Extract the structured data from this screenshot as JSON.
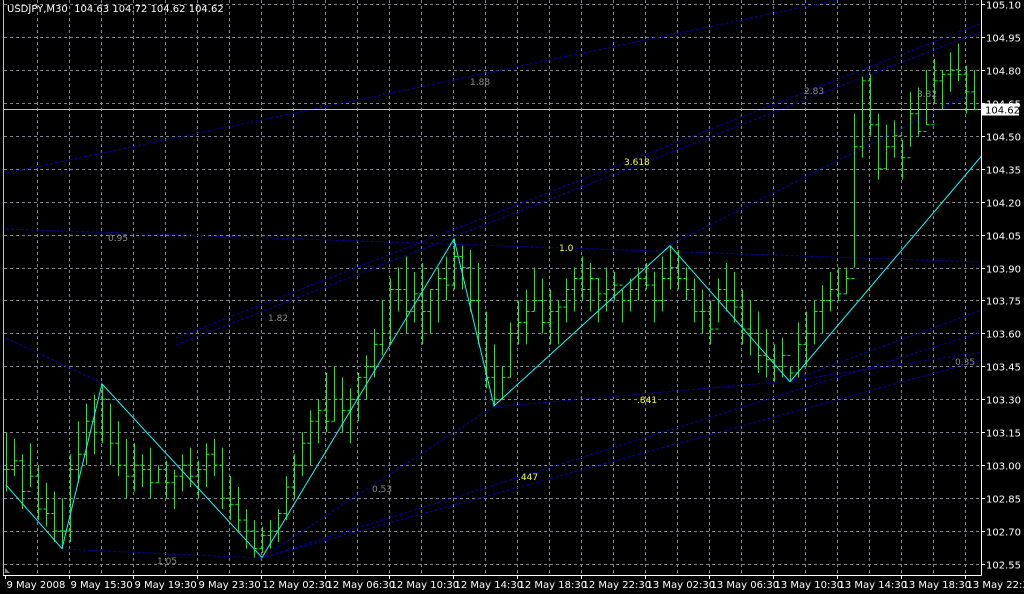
{
  "header": {
    "symbol": "USDJPY,M30",
    "open": "104.63",
    "high": "104.72",
    "low": "104.62",
    "close": "104.62"
  },
  "colors": {
    "background": "#000000",
    "grid": "#778899",
    "bars": "#00ff00",
    "zigzag": "#00ffff",
    "fib_lines": "#0000b0",
    "fib_label_gray": "#8c8c8c",
    "fib_label_yellow": "#ffff00",
    "axis": "#ffffff",
    "current_price_line": "#c0c0c0"
  },
  "chart_data": {
    "type": "ohlc-bar",
    "timeframe": "M30",
    "grid": true,
    "ylim": [
      102.55,
      105.1
    ],
    "price_ticks": [
      "105.10",
      "104.95",
      "104.80",
      "104.65",
      "104.50",
      "104.35",
      "104.20",
      "104.05",
      "103.90",
      "103.75",
      "103.60",
      "103.45",
      "103.30",
      "103.15",
      "103.00",
      "102.85",
      "102.70",
      "102.55"
    ],
    "time_ticks": [
      "9 May 2008",
      "9 May 15:30",
      "9 May 19:30",
      "9 May 23:30",
      "12 May 02:30",
      "12 May 06:30",
      "12 May 10:30",
      "12 May 14:30",
      "12 May 18:30",
      "12 May 22:30",
      "13 May 02:30",
      "13 May 06:30",
      "13 May 10:30",
      "13 May 14:30",
      "13 May 18:30",
      "13 May 22:30"
    ],
    "current_price": "104.62",
    "bars": {
      "high": [
        103.15,
        103.12,
        103.05,
        103.1,
        103.0,
        102.92,
        102.88,
        102.85,
        103.05,
        103.2,
        103.28,
        103.32,
        103.37,
        103.28,
        103.2,
        103.12,
        103.1,
        103.05,
        103.08,
        103.0,
        103.02,
        102.98,
        103.05,
        103.08,
        103.02,
        103.1,
        103.12,
        103.08,
        102.95,
        102.9,
        102.8,
        102.75,
        102.72,
        102.75,
        102.8,
        102.95,
        103.05,
        103.15,
        103.25,
        103.3,
        103.42,
        103.45,
        103.4,
        103.35,
        103.42,
        103.5,
        103.62,
        103.75,
        103.85,
        103.9,
        103.95,
        103.88,
        103.92,
        103.8,
        103.9,
        103.95,
        104.03,
        104.0,
        103.98,
        103.92,
        103.7,
        103.55,
        103.45,
        103.65,
        103.75,
        103.8,
        103.9,
        103.85,
        103.8,
        103.75,
        103.85,
        103.9,
        103.95,
        103.92,
        103.85,
        103.9,
        103.88,
        103.8,
        103.85,
        103.9,
        103.92,
        103.88,
        103.95,
        104.0,
        103.98,
        103.9,
        103.85,
        103.8,
        103.75,
        103.85,
        103.92,
        103.88,
        103.8,
        103.75,
        103.7,
        103.62,
        103.55,
        103.58,
        103.45,
        103.65,
        103.7,
        103.75,
        103.82,
        103.88,
        103.9,
        103.9,
        104.6,
        104.77,
        104.78,
        104.6,
        104.55,
        104.57,
        104.48,
        104.7,
        104.72,
        104.8,
        104.85,
        104.8,
        104.88,
        104.92,
        104.82,
        104.8
      ],
      "low": [
        102.88,
        102.95,
        102.8,
        102.9,
        102.75,
        102.72,
        102.65,
        102.62,
        102.65,
        102.92,
        103.0,
        103.05,
        103.1,
        103.0,
        102.95,
        102.85,
        102.88,
        102.9,
        102.85,
        102.92,
        102.85,
        102.8,
        102.88,
        102.9,
        102.85,
        102.9,
        102.95,
        102.8,
        102.75,
        102.7,
        102.62,
        102.58,
        102.6,
        102.62,
        102.65,
        102.75,
        102.85,
        102.95,
        103.0,
        103.1,
        103.15,
        103.2,
        103.15,
        103.1,
        103.2,
        103.3,
        103.4,
        103.5,
        103.55,
        103.7,
        103.6,
        103.65,
        103.55,
        103.6,
        103.65,
        103.75,
        103.8,
        103.8,
        103.7,
        103.55,
        103.35,
        103.27,
        103.3,
        103.4,
        103.55,
        103.55,
        103.7,
        103.6,
        103.55,
        103.55,
        103.65,
        103.7,
        103.75,
        103.7,
        103.65,
        103.7,
        103.75,
        103.65,
        103.7,
        103.75,
        103.8,
        103.65,
        103.7,
        103.8,
        103.8,
        103.75,
        103.65,
        103.6,
        103.55,
        103.65,
        103.7,
        103.65,
        103.55,
        103.5,
        103.42,
        103.4,
        103.38,
        103.4,
        103.38,
        103.4,
        103.45,
        103.55,
        103.6,
        103.7,
        103.75,
        103.78,
        103.9,
        104.4,
        104.5,
        104.3,
        104.35,
        104.4,
        104.3,
        104.45,
        104.5,
        104.55,
        104.65,
        104.62,
        104.7,
        104.75,
        104.6,
        104.62
      ],
      "close": [
        102.98,
        103.02,
        102.88,
        102.95,
        102.8,
        102.78,
        102.7,
        102.7,
        102.98,
        103.05,
        103.2,
        103.15,
        103.3,
        103.1,
        103.0,
        102.95,
        103.0,
        102.98,
        102.92,
        102.98,
        102.92,
        102.95,
        103.0,
        102.95,
        102.98,
        103.05,
        103.0,
        102.85,
        102.82,
        102.75,
        102.7,
        102.62,
        102.68,
        102.7,
        102.78,
        102.9,
        103.0,
        103.1,
        103.2,
        103.25,
        103.2,
        103.3,
        103.25,
        103.3,
        103.4,
        103.45,
        103.55,
        103.6,
        103.8,
        103.8,
        103.7,
        103.78,
        103.7,
        103.8,
        103.85,
        103.82,
        103.95,
        103.9,
        103.75,
        103.6,
        103.4,
        103.3,
        103.4,
        103.6,
        103.65,
        103.7,
        103.75,
        103.65,
        103.7,
        103.72,
        103.8,
        103.85,
        103.8,
        103.85,
        103.78,
        103.8,
        103.82,
        103.75,
        103.8,
        103.85,
        103.82,
        103.75,
        103.85,
        103.9,
        103.85,
        103.8,
        103.7,
        103.7,
        103.62,
        103.8,
        103.75,
        103.72,
        103.62,
        103.6,
        103.5,
        103.48,
        103.45,
        103.5,
        103.42,
        103.55,
        103.6,
        103.7,
        103.75,
        103.8,
        103.78,
        103.85,
        104.45,
        104.75,
        104.55,
        104.35,
        104.45,
        104.5,
        104.4,
        104.6,
        104.52,
        104.55,
        104.75,
        104.78,
        104.8,
        104.78,
        104.7,
        104.62
      ]
    },
    "zigzag": [
      {
        "bar": 0,
        "price": 102.91
      },
      {
        "bar": 7,
        "price": 102.62
      },
      {
        "bar": 12,
        "price": 103.37
      },
      {
        "bar": 32,
        "price": 102.58
      },
      {
        "bar": 56,
        "price": 104.03
      },
      {
        "bar": 61,
        "price": 103.27
      },
      {
        "bar": 83,
        "price": 104.0
      },
      {
        "bar": 98,
        "price": 103.38
      },
      {
        "bar": 122,
        "price": 104.41
      }
    ],
    "fib_lines": [
      {
        "from": [
          0,
          104.33
        ],
        "to": [
          122,
          105.255
        ]
      },
      {
        "from": [
          21.25,
          103.579
        ],
        "to": [
          122,
          105.013
        ]
      },
      {
        "from": [
          21.25,
          103.547
        ],
        "to": [
          122,
          104.977
        ]
      },
      {
        "from": [
          0,
          104.075
        ],
        "to": [
          122,
          103.925
        ]
      },
      {
        "from": [
          0,
          103.579
        ],
        "to": [
          12,
          103.374
        ]
      },
      {
        "from": [
          83,
          104.003
        ],
        "to": [
          122,
          104.717
        ]
      },
      {
        "from": [
          7.1,
          102.618
        ],
        "to": [
          31.9,
          102.577
        ]
      },
      {
        "from": [
          31.9,
          102.577
        ],
        "to": [
          60.9,
          103.265
        ]
      },
      {
        "from": [
          31.9,
          102.577
        ],
        "to": [
          122,
          103.606
        ]
      },
      {
        "from": [
          31.9,
          102.577
        ],
        "to": [
          122,
          103.479
        ]
      },
      {
        "from": [
          60.9,
          103.265
        ],
        "to": [
          97.9,
          103.383
        ]
      },
      {
        "from": [
          97.9,
          103.383
        ],
        "to": [
          122,
          103.707
        ]
      },
      {
        "from": [
          97.9,
          103.383
        ],
        "to": [
          122,
          103.515
        ]
      }
    ],
    "fib_labels": [
      {
        "text": "1.88",
        "color": "gray"
      },
      {
        "text": "2.83",
        "color": "gray"
      },
      {
        "text": "3.32",
        "color": "gray"
      },
      {
        "text": "3.618",
        "color": "yellow"
      },
      {
        "text": "0.95",
        "color": "gray"
      },
      {
        "text": "1.0",
        "color": "yellow"
      },
      {
        "text": "1.82",
        "color": "gray"
      },
      {
        "text": ".841",
        "color": "yellow"
      },
      {
        "text": "0.35",
        "color": "gray"
      },
      {
        "text": ".447",
        "color": "yellow"
      },
      {
        "text": "0.53",
        "color": "gray"
      },
      {
        "text": "1.05",
        "color": "gray"
      }
    ]
  }
}
